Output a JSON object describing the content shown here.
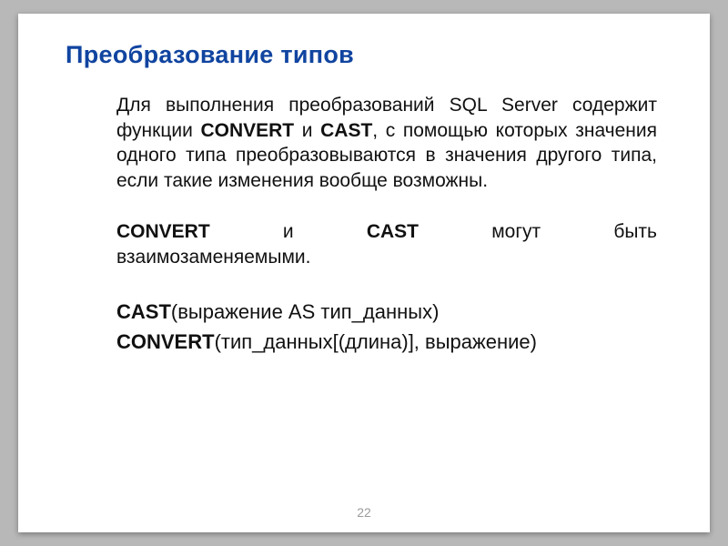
{
  "title": "Преобразование типов",
  "p1_a": "Для выполнения преобразований SQL Server содержит функции ",
  "p1_convert": "CONVERT",
  "p1_b": " и ",
  "p1_cast": "CAST",
  "p1_c": ", с помощью которых значения одного типа преобразовываются в значения другого типа, если такие изменения вообще возможны.",
  "p2_l1_w1": "CONVERT",
  "p2_l1_w2": "и",
  "p2_l1_w3": "CAST",
  "p2_l1_w4": "могут",
  "p2_l1_w5": "быть",
  "p2_l2": "взаимозаменяемыми.",
  "syntax_cast_a": "CAST",
  "syntax_cast_b": "(выражение AS тип_данных)",
  "syntax_conv_a": "CONVERT",
  "syntax_conv_b": "(тип_данных[(длина)], выражение)",
  "page_number": "22"
}
